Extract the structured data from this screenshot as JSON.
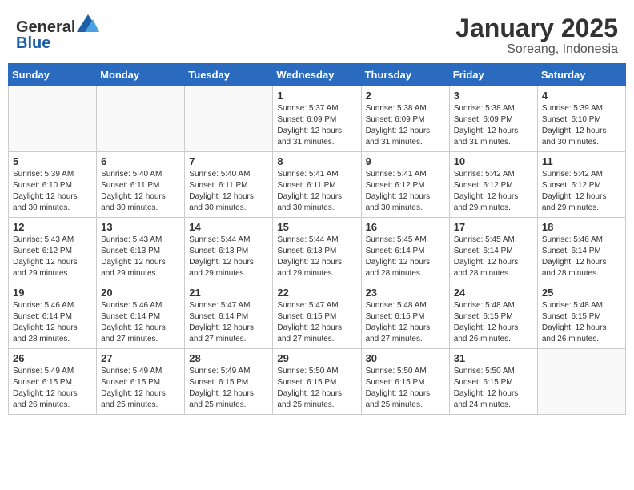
{
  "logo": {
    "general": "General",
    "blue": "Blue"
  },
  "title": "January 2025",
  "location": "Soreang, Indonesia",
  "days_of_week": [
    "Sunday",
    "Monday",
    "Tuesday",
    "Wednesday",
    "Thursday",
    "Friday",
    "Saturday"
  ],
  "weeks": [
    [
      {
        "day": "",
        "info": ""
      },
      {
        "day": "",
        "info": ""
      },
      {
        "day": "",
        "info": ""
      },
      {
        "day": "1",
        "info": "Sunrise: 5:37 AM\nSunset: 6:09 PM\nDaylight: 12 hours\nand 31 minutes."
      },
      {
        "day": "2",
        "info": "Sunrise: 5:38 AM\nSunset: 6:09 PM\nDaylight: 12 hours\nand 31 minutes."
      },
      {
        "day": "3",
        "info": "Sunrise: 5:38 AM\nSunset: 6:09 PM\nDaylight: 12 hours\nand 31 minutes."
      },
      {
        "day": "4",
        "info": "Sunrise: 5:39 AM\nSunset: 6:10 PM\nDaylight: 12 hours\nand 30 minutes."
      }
    ],
    [
      {
        "day": "5",
        "info": "Sunrise: 5:39 AM\nSunset: 6:10 PM\nDaylight: 12 hours\nand 30 minutes."
      },
      {
        "day": "6",
        "info": "Sunrise: 5:40 AM\nSunset: 6:11 PM\nDaylight: 12 hours\nand 30 minutes."
      },
      {
        "day": "7",
        "info": "Sunrise: 5:40 AM\nSunset: 6:11 PM\nDaylight: 12 hours\nand 30 minutes."
      },
      {
        "day": "8",
        "info": "Sunrise: 5:41 AM\nSunset: 6:11 PM\nDaylight: 12 hours\nand 30 minutes."
      },
      {
        "day": "9",
        "info": "Sunrise: 5:41 AM\nSunset: 6:12 PM\nDaylight: 12 hours\nand 30 minutes."
      },
      {
        "day": "10",
        "info": "Sunrise: 5:42 AM\nSunset: 6:12 PM\nDaylight: 12 hours\nand 29 minutes."
      },
      {
        "day": "11",
        "info": "Sunrise: 5:42 AM\nSunset: 6:12 PM\nDaylight: 12 hours\nand 29 minutes."
      }
    ],
    [
      {
        "day": "12",
        "info": "Sunrise: 5:43 AM\nSunset: 6:12 PM\nDaylight: 12 hours\nand 29 minutes."
      },
      {
        "day": "13",
        "info": "Sunrise: 5:43 AM\nSunset: 6:13 PM\nDaylight: 12 hours\nand 29 minutes."
      },
      {
        "day": "14",
        "info": "Sunrise: 5:44 AM\nSunset: 6:13 PM\nDaylight: 12 hours\nand 29 minutes."
      },
      {
        "day": "15",
        "info": "Sunrise: 5:44 AM\nSunset: 6:13 PM\nDaylight: 12 hours\nand 29 minutes."
      },
      {
        "day": "16",
        "info": "Sunrise: 5:45 AM\nSunset: 6:14 PM\nDaylight: 12 hours\nand 28 minutes."
      },
      {
        "day": "17",
        "info": "Sunrise: 5:45 AM\nSunset: 6:14 PM\nDaylight: 12 hours\nand 28 minutes."
      },
      {
        "day": "18",
        "info": "Sunrise: 5:46 AM\nSunset: 6:14 PM\nDaylight: 12 hours\nand 28 minutes."
      }
    ],
    [
      {
        "day": "19",
        "info": "Sunrise: 5:46 AM\nSunset: 6:14 PM\nDaylight: 12 hours\nand 28 minutes."
      },
      {
        "day": "20",
        "info": "Sunrise: 5:46 AM\nSunset: 6:14 PM\nDaylight: 12 hours\nand 27 minutes."
      },
      {
        "day": "21",
        "info": "Sunrise: 5:47 AM\nSunset: 6:14 PM\nDaylight: 12 hours\nand 27 minutes."
      },
      {
        "day": "22",
        "info": "Sunrise: 5:47 AM\nSunset: 6:15 PM\nDaylight: 12 hours\nand 27 minutes."
      },
      {
        "day": "23",
        "info": "Sunrise: 5:48 AM\nSunset: 6:15 PM\nDaylight: 12 hours\nand 27 minutes."
      },
      {
        "day": "24",
        "info": "Sunrise: 5:48 AM\nSunset: 6:15 PM\nDaylight: 12 hours\nand 26 minutes."
      },
      {
        "day": "25",
        "info": "Sunrise: 5:48 AM\nSunset: 6:15 PM\nDaylight: 12 hours\nand 26 minutes."
      }
    ],
    [
      {
        "day": "26",
        "info": "Sunrise: 5:49 AM\nSunset: 6:15 PM\nDaylight: 12 hours\nand 26 minutes."
      },
      {
        "day": "27",
        "info": "Sunrise: 5:49 AM\nSunset: 6:15 PM\nDaylight: 12 hours\nand 25 minutes."
      },
      {
        "day": "28",
        "info": "Sunrise: 5:49 AM\nSunset: 6:15 PM\nDaylight: 12 hours\nand 25 minutes."
      },
      {
        "day": "29",
        "info": "Sunrise: 5:50 AM\nSunset: 6:15 PM\nDaylight: 12 hours\nand 25 minutes."
      },
      {
        "day": "30",
        "info": "Sunrise: 5:50 AM\nSunset: 6:15 PM\nDaylight: 12 hours\nand 25 minutes."
      },
      {
        "day": "31",
        "info": "Sunrise: 5:50 AM\nSunset: 6:15 PM\nDaylight: 12 hours\nand 24 minutes."
      },
      {
        "day": "",
        "info": ""
      }
    ]
  ]
}
